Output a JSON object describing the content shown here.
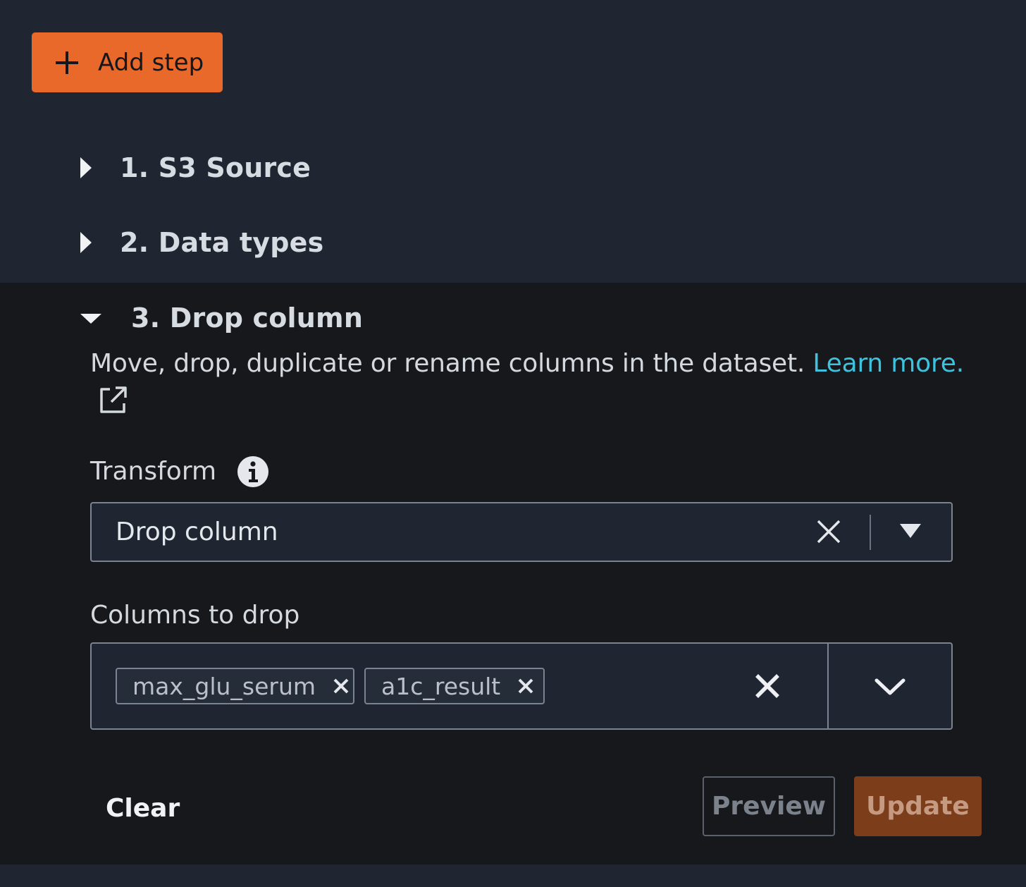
{
  "toolbar": {
    "add_step_label": "Add step"
  },
  "steps": [
    {
      "label": "1. S3 Source",
      "expanded": false
    },
    {
      "label": "2. Data types",
      "expanded": false
    },
    {
      "label": "3. Drop column",
      "expanded": true
    }
  ],
  "drop_column": {
    "description": "Move, drop, duplicate or rename columns in the dataset.",
    "learn_more": "Learn more.",
    "transform_label": "Transform",
    "transform_value": "Drop column",
    "columns_label": "Columns to drop",
    "columns": [
      "max_glu_serum",
      "a1c_result"
    ]
  },
  "actions": {
    "clear": "Clear",
    "preview": "Preview",
    "update": "Update"
  },
  "colors": {
    "accent": "#e8692a",
    "link": "#3ec3df",
    "panel_bg": "#16181c",
    "page_bg": "#1f2631"
  }
}
